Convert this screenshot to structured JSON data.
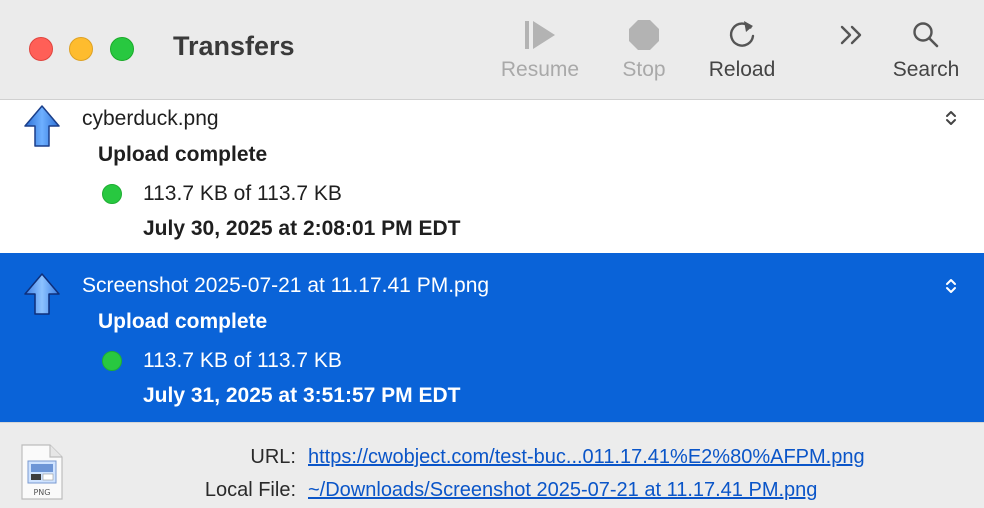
{
  "window": {
    "title": "Transfers"
  },
  "toolbar": {
    "resume_label": "Resume",
    "stop_label": "Stop",
    "reload_label": "Reload",
    "search_label": "Search"
  },
  "transfers": [
    {
      "filename": "cyberduck.png",
      "status": "Upload complete",
      "progress": "113.7 KB of 113.7 KB",
      "date": "July 30, 2025 at 2:08:01 PM EDT",
      "selected": false
    },
    {
      "filename": "Screenshot 2025-07-21 at 11.17.41 PM.png",
      "status": "Upload complete",
      "progress": "113.7 KB of 113.7 KB",
      "date": "July 31, 2025 at 3:51:57 PM EDT",
      "selected": true
    }
  ],
  "details": {
    "file_type": "PNG",
    "url_label": "URL:",
    "url_value": "https://cwobject.com/test-buc...011.17.41%E2%80%AFPM.png",
    "local_label": "Local File:",
    "local_value": "~/Downloads/Screenshot 2025-07-21 at 11.17.41 PM.png"
  },
  "colors": {
    "selection": "#0a63d8",
    "status_dot": "#28c840",
    "link": "#0a55c8"
  }
}
